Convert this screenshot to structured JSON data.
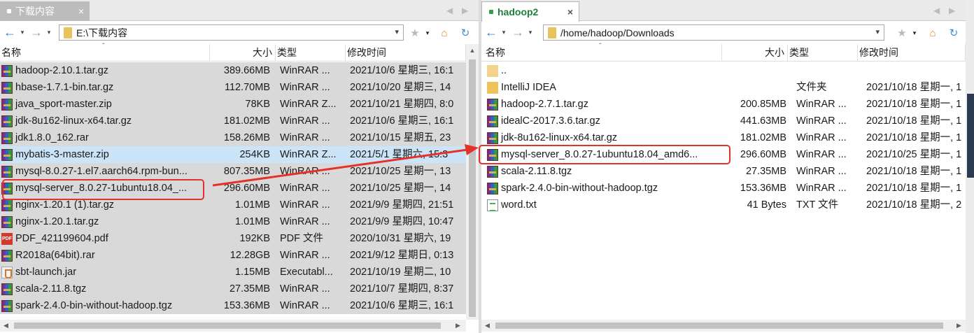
{
  "left": {
    "tab": {
      "label": "下载内容",
      "close": "×"
    },
    "tab_nav": {
      "prev": "◀",
      "next": "▶"
    },
    "address": "E:\\下载内容",
    "headers": {
      "name": "名称",
      "size": "大小",
      "type": "类型",
      "modified": "修改时间"
    },
    "files": [
      {
        "name": "hadoop-2.10.1.tar.gz",
        "size": "389.66MB",
        "type": "WinRAR ...",
        "modified": "2021/10/6 星期三, 16:1",
        "icon": "rar-icon"
      },
      {
        "name": "hbase-1.7.1-bin.tar.gz",
        "size": "112.70MB",
        "type": "WinRAR ...",
        "modified": "2021/10/20 星期三, 14",
        "icon": "rar-icon"
      },
      {
        "name": "java_sport-master.zip",
        "size": "78KB",
        "type": "WinRAR Z...",
        "modified": "2021/10/21 星期四, 8:0",
        "icon": "rar-icon"
      },
      {
        "name": "jdk-8u162-linux-x64.tar.gz",
        "size": "181.02MB",
        "type": "WinRAR ...",
        "modified": "2021/10/6 星期三, 16:1",
        "icon": "rar-icon"
      },
      {
        "name": "jdk1.8.0_162.rar",
        "size": "158.26MB",
        "type": "WinRAR ...",
        "modified": "2021/10/15 星期五, 23",
        "icon": "rar-icon"
      },
      {
        "name": "mybatis-3-master.zip",
        "size": "254KB",
        "type": "WinRAR Z...",
        "modified": "2021/5/1 星期六, 15:3",
        "icon": "rar-icon",
        "selected": true
      },
      {
        "name": "mysql-8.0.27-1.el7.aarch64.rpm-bun...",
        "size": "807.35MB",
        "type": "WinRAR ...",
        "modified": "2021/10/25 星期一, 13",
        "icon": "rar-icon"
      },
      {
        "name": "mysql-server_8.0.27-1ubuntu18.04_...",
        "size": "296.60MB",
        "type": "WinRAR ...",
        "modified": "2021/10/25 星期一, 14",
        "icon": "rar-icon"
      },
      {
        "name": "nginx-1.20.1 (1).tar.gz",
        "size": "1.01MB",
        "type": "WinRAR ...",
        "modified": "2021/9/9 星期四, 21:51",
        "icon": "rar-icon"
      },
      {
        "name": "nginx-1.20.1.tar.gz",
        "size": "1.01MB",
        "type": "WinRAR ...",
        "modified": "2021/9/9 星期四, 10:47",
        "icon": "rar-icon"
      },
      {
        "name": "PDF_421199604.pdf",
        "size": "192KB",
        "type": "PDF 文件",
        "modified": "2020/10/31 星期六, 19",
        "icon": "pdf-icon"
      },
      {
        "name": "R2018a(64bit).rar",
        "size": "12.28GB",
        "type": "WinRAR ...",
        "modified": "2021/9/12 星期日, 0:13",
        "icon": "rar-icon"
      },
      {
        "name": "sbt-launch.jar",
        "size": "1.15MB",
        "type": "Executabl...",
        "modified": "2021/10/19 星期二, 10",
        "icon": "jar-icon"
      },
      {
        "name": "scala-2.11.8.tgz",
        "size": "27.35MB",
        "type": "WinRAR ...",
        "modified": "2021/10/7 星期四, 8:37",
        "icon": "rar-icon"
      },
      {
        "name": "spark-2.4.0-bin-without-hadoop.tgz",
        "size": "153.36MB",
        "type": "WinRAR ...",
        "modified": "2021/10/6 星期三, 16:1",
        "icon": "rar-icon"
      }
    ]
  },
  "right": {
    "tab": {
      "label": "hadoop2",
      "close": "×"
    },
    "tab_nav": {
      "prev": "◀",
      "next": "▶"
    },
    "address": "/home/hadoop/Downloads",
    "headers": {
      "name": "名称",
      "size": "大小",
      "type": "类型",
      "modified": "修改时间"
    },
    "files": [
      {
        "name": "..",
        "size": "",
        "type": "",
        "modified": "",
        "icon": "parent-folder-icon"
      },
      {
        "name": "IntelliJ IDEA",
        "size": "",
        "type": "文件夹",
        "modified": "2021/10/18 星期一, 1",
        "icon": "folder-icon"
      },
      {
        "name": "hadoop-2.7.1.tar.gz",
        "size": "200.85MB",
        "type": "WinRAR ...",
        "modified": "2021/10/18 星期一, 1",
        "icon": "rar-icon"
      },
      {
        "name": "idealC-2017.3.6.tar.gz",
        "size": "441.63MB",
        "type": "WinRAR ...",
        "modified": "2021/10/18 星期一, 1",
        "icon": "rar-icon"
      },
      {
        "name": "jdk-8u162-linux-x64.tar.gz",
        "size": "181.02MB",
        "type": "WinRAR ...",
        "modified": "2021/10/18 星期一, 1",
        "icon": "rar-icon"
      },
      {
        "name": "mysql-server_8.0.27-1ubuntu18.04_amd6...",
        "size": "296.60MB",
        "type": "WinRAR ...",
        "modified": "2021/10/25 星期一, 1",
        "icon": "rar-icon"
      },
      {
        "name": "scala-2.11.8.tgz",
        "size": "27.35MB",
        "type": "WinRAR ...",
        "modified": "2021/10/18 星期一, 1",
        "icon": "rar-icon"
      },
      {
        "name": "spark-2.4.0-bin-without-hadoop.tgz",
        "size": "153.36MB",
        "type": "WinRAR ...",
        "modified": "2021/10/18 星期一, 1",
        "icon": "rar-icon"
      },
      {
        "name": "word.txt",
        "size": "41 Bytes",
        "type": "TXT 文件",
        "modified": "2021/10/18 星期一, 2",
        "icon": "txt-icon"
      }
    ]
  },
  "colors": {
    "highlight": "#e4322b",
    "tab_active_text": "#1d7f3e",
    "selected_row": "#cce4f7"
  },
  "icons": {
    "back": "←",
    "forward": "→",
    "dropdown": "▾",
    "favorite": "★",
    "home": "⌂",
    "refresh": "↻",
    "sort": "⌃",
    "scroll_up": "▲",
    "scroll_left": "◀",
    "scroll_right": "▶"
  }
}
